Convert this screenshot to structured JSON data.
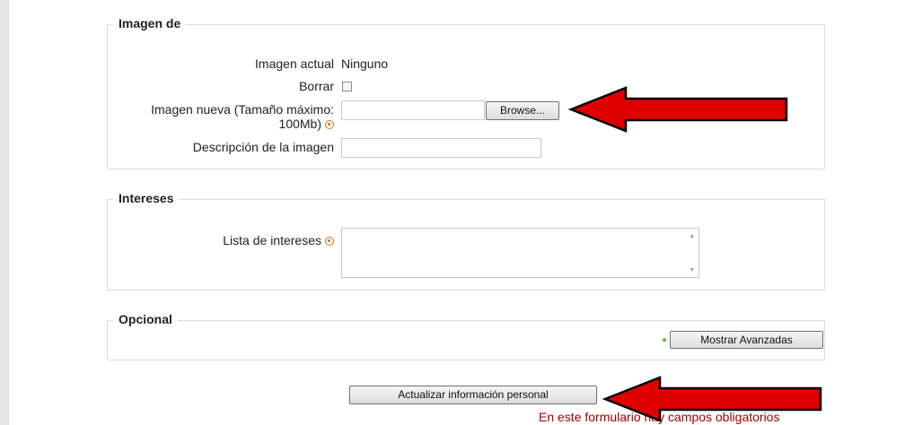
{
  "sections": {
    "image": {
      "legend": "Imagen de",
      "current_label": "Imagen actual",
      "current_value": "Ninguno",
      "delete_label": "Borrar",
      "new_image_label_line1": "Imagen nueva (Tamaño máximo:",
      "new_image_label_line2": "100Mb)",
      "browse_button": "Browse...",
      "description_label": "Descripción de la imagen"
    },
    "interests": {
      "legend": "Intereses",
      "list_label": "Lista de intereses"
    },
    "optional": {
      "legend": "Opcional",
      "show_advanced_button": "Mostrar Avanzadas"
    }
  },
  "submit_button": "Actualizar información personal",
  "required_note": "En este formulario hay campos obligatorios",
  "colors": {
    "arrow_fill": "#e00000",
    "required_text": "#a40000",
    "help_icon": "#e36a1a"
  },
  "icons": {
    "help": "help-icon",
    "arrow": "red-arrow-left"
  }
}
